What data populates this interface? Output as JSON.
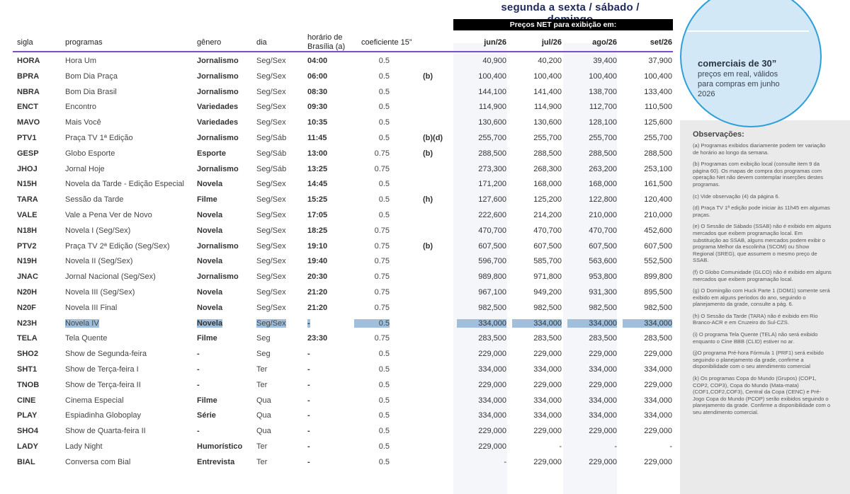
{
  "header": {
    "title": "segunda a sexta / sábado / domingo",
    "price_bar": "Preços NET para exibição em:"
  },
  "columns": {
    "sigla": "sigla",
    "programas": "programas",
    "genero": "gênero",
    "dia": "dia",
    "horario_1": "horário de",
    "horario_2": "Brasília (a)",
    "coeficiente": "coeficiente 15”",
    "months": [
      "jun/26",
      "jul/26",
      "ago/26",
      "set/26"
    ]
  },
  "rows": [
    {
      "sigla": "HORA",
      "programa": "Hora Um",
      "genero": "Jornalismo",
      "dia": "Seg/Sex",
      "horario": "04:00",
      "coef": "0.5",
      "nota": "",
      "jun": "40,900",
      "jul": "40,200",
      "ago": "39,400",
      "set": "37,900"
    },
    {
      "sigla": "BPRA",
      "programa": "Bom Dia Praça",
      "genero": "Jornalismo",
      "dia": "Seg/Sex",
      "horario": "06:00",
      "coef": "0.5",
      "nota": "(b)",
      "jun": "100,400",
      "jul": "100,400",
      "ago": "100,400",
      "set": "100,400"
    },
    {
      "sigla": "NBRA",
      "programa": "Bom Dia Brasil",
      "genero": "Jornalismo",
      "dia": "Seg/Sex",
      "horario": "08:30",
      "coef": "0.5",
      "nota": "",
      "jun": "144,100",
      "jul": "141,400",
      "ago": "138,700",
      "set": "133,400"
    },
    {
      "sigla": "ENCT",
      "programa": "Encontro",
      "genero": "Variedades",
      "dia": "Seg/Sex",
      "horario": "09:30",
      "coef": "0.5",
      "nota": "",
      "jun": "114,900",
      "jul": "114,900",
      "ago": "112,700",
      "set": "110,500"
    },
    {
      "sigla": "MAVO",
      "programa": "Mais Você",
      "genero": "Variedades",
      "dia": "Seg/Sex",
      "horario": "10:35",
      "coef": "0.5",
      "nota": "",
      "jun": "130,600",
      "jul": "130,600",
      "ago": "128,100",
      "set": "125,600"
    },
    {
      "sigla": "PTV1",
      "programa": "Praça TV 1ª Edição",
      "genero": "Jornalismo",
      "dia": "Seg/Sáb",
      "horario": "11:45",
      "coef": "0.5",
      "nota": "(b)(d)",
      "jun": "255,700",
      "jul": "255,700",
      "ago": "255,700",
      "set": "255,700"
    },
    {
      "sigla": "GESP",
      "programa": "Globo Esporte",
      "genero": "Esporte",
      "dia": "Seg/Sáb",
      "horario": "13:00",
      "coef": "0.75",
      "nota": "(b)",
      "jun": "288,500",
      "jul": "288,500",
      "ago": "288,500",
      "set": "288,500"
    },
    {
      "sigla": "JHOJ",
      "programa": "Jornal Hoje",
      "genero": "Jornalismo",
      "dia": "Seg/Sáb",
      "horario": "13:25",
      "coef": "0.75",
      "nota": "",
      "jun": "273,300",
      "jul": "268,300",
      "ago": "263,200",
      "set": "253,100"
    },
    {
      "sigla": "N15H",
      "programa": "Novela da Tarde - Edição Especial",
      "genero": "Novela",
      "dia": "Seg/Sex",
      "horario": "14:45",
      "coef": "0.5",
      "nota": "",
      "jun": "171,200",
      "jul": "168,000",
      "ago": "168,000",
      "set": "161,500"
    },
    {
      "sigla": "TARA",
      "programa": "Sessão da Tarde",
      "genero": "Filme",
      "dia": "Seg/Sex",
      "horario": "15:25",
      "coef": "0.5",
      "nota": "(h)",
      "jun": "127,600",
      "jul": "125,200",
      "ago": "122,800",
      "set": "120,400"
    },
    {
      "sigla": "VALE",
      "programa": "Vale a Pena Ver de Novo",
      "genero": "Novela",
      "dia": "Seg/Sex",
      "horario": "17:05",
      "coef": "0.5",
      "nota": "",
      "jun": "222,600",
      "jul": "214,200",
      "ago": "210,000",
      "set": "210,000"
    },
    {
      "sigla": "N18H",
      "programa": "Novela I (Seg/Sex)",
      "genero": "Novela",
      "dia": "Seg/Sex",
      "horario": "18:25",
      "coef": "0.75",
      "nota": "",
      "jun": "470,700",
      "jul": "470,700",
      "ago": "470,700",
      "set": "452,600"
    },
    {
      "sigla": "PTV2",
      "programa": "Praça TV 2ª Edição (Seg/Sex)",
      "genero": "Jornalismo",
      "dia": "Seg/Sex",
      "horario": "19:10",
      "coef": "0.75",
      "nota": "(b)",
      "jun": "607,500",
      "jul": "607,500",
      "ago": "607,500",
      "set": "607,500"
    },
    {
      "sigla": "N19H",
      "programa": "Novela II (Seg/Sex)",
      "genero": "Novela",
      "dia": "Seg/Sex",
      "horario": "19:40",
      "coef": "0.75",
      "nota": "",
      "jun": "596,700",
      "jul": "585,700",
      "ago": "563,600",
      "set": "552,500"
    },
    {
      "sigla": "JNAC",
      "programa": "Jornal Nacional (Seg/Sex)",
      "genero": "Jornalismo",
      "dia": "Seg/Sex",
      "horario": "20:30",
      "coef": "0.75",
      "nota": "",
      "jun": "989,800",
      "jul": "971,800",
      "ago": "953,800",
      "set": "899,800"
    },
    {
      "sigla": "N20H",
      "programa": "Novela III (Seg/Sex)",
      "genero": "Novela",
      "dia": "Seg/Sex",
      "horario": "21:20",
      "coef": "0.75",
      "nota": "",
      "jun": "967,100",
      "jul": "949,200",
      "ago": "931,300",
      "set": "895,500"
    },
    {
      "sigla": "N20F",
      "programa": "Novela III Final",
      "genero": "Novela",
      "dia": "Seg/Sex",
      "horario": "21:20",
      "coef": "0.75",
      "nota": "",
      "jun": "982,500",
      "jul": "982,500",
      "ago": "982,500",
      "set": "982,500"
    },
    {
      "sigla": "N23H",
      "programa": "Novela IV",
      "genero": "Novela",
      "dia": "Seg/Sex",
      "horario": "-",
      "coef": "0.5",
      "nota": "",
      "jun": "334,000",
      "jul": "334,000",
      "ago": "334,000",
      "set": "334,000",
      "selected": true
    },
    {
      "sigla": "TELA",
      "programa": "Tela Quente",
      "genero": "Filme",
      "dia": "Seg",
      "horario": "23:30",
      "coef": "0.75",
      "nota": "",
      "jun": "283,500",
      "jul": "283,500",
      "ago": "283,500",
      "set": "283,500"
    },
    {
      "sigla": "SHO2",
      "programa": "Show de Segunda-feira",
      "genero": "-",
      "dia": "Seg",
      "horario": "-",
      "coef": "0.5",
      "nota": "",
      "jun": "229,000",
      "jul": "229,000",
      "ago": "229,000",
      "set": "229,000"
    },
    {
      "sigla": "SHT1",
      "programa": "Show de Terça-feira I",
      "genero": "-",
      "dia": "Ter",
      "horario": "-",
      "coef": "0.5",
      "nota": "",
      "jun": "334,000",
      "jul": "334,000",
      "ago": "334,000",
      "set": "334,000"
    },
    {
      "sigla": "TNOB",
      "programa": "Show de Terça-feira II",
      "genero": "-",
      "dia": "Ter",
      "horario": "-",
      "coef": "0.5",
      "nota": "",
      "jun": "229,000",
      "jul": "229,000",
      "ago": "229,000",
      "set": "229,000"
    },
    {
      "sigla": "CINE",
      "programa": "Cinema Especial",
      "genero": "Filme",
      "dia": "Qua",
      "horario": "-",
      "coef": "0.5",
      "nota": "",
      "jun": "334,000",
      "jul": "334,000",
      "ago": "334,000",
      "set": "334,000"
    },
    {
      "sigla": "PLAY",
      "programa": "Espiadinha Globoplay",
      "genero": "Série",
      "dia": "Qua",
      "horario": "-",
      "coef": "0.5",
      "nota": "",
      "jun": "334,000",
      "jul": "334,000",
      "ago": "334,000",
      "set": "334,000"
    },
    {
      "sigla": "SHO4",
      "programa": "Show de Quarta-feira II",
      "genero": "-",
      "dia": "Qua",
      "horario": "-",
      "coef": "0.5",
      "nota": "",
      "jun": "229,000",
      "jul": "229,000",
      "ago": "229,000",
      "set": "229,000"
    },
    {
      "sigla": "LADY",
      "programa": "Lady Night",
      "genero": "Humorístico",
      "dia": "Ter",
      "horario": "-",
      "coef": "0.5",
      "nota": "",
      "jun": "229,000",
      "jul": "-",
      "ago": "-",
      "set": "-"
    },
    {
      "sigla": "BIAL",
      "programa": "Conversa com Bial",
      "genero": "Entrevista",
      "dia": "Ter",
      "horario": "-",
      "coef": "0.5",
      "nota": "",
      "jun": "-",
      "jul": "229,000",
      "ago": "229,000",
      "set": "229,000"
    }
  ],
  "callout": {
    "title": "comerciais de 30”",
    "subtitle": "preços em real, válidos para compras em junho 2026"
  },
  "observations": {
    "title": "Observações:",
    "items": [
      "(a) Programas exibidos diariamente podem ter variação de horário ao longo da semana.",
      "(b) Programas com exibição local (consulte item 9 da página 60). Os mapas de compra dos programas com operação Net não devem contemplar inserções destes programas.",
      "(c) Vide observação (4) da página 6.",
      "(d) Praça TV 1ª edição pode iniciar às 11h45 em algumas praças.",
      "(e) O Sessão de Sábado (SSAB) não é exibido em alguns mercados que exibem programação local. Em substituição ao SSAB, alguns mercados podem exibir o programa Melhor da escolinha (SCOM) ou Show Regional (SREG), que assumem o mesmo preço de SSAB.",
      "(f) O Globo Comunidade (GLCO) não é exibido em alguns mercados que exibem programação local.",
      "(g) O Domingão com Huck  Parte 1 (DOM1) somente será exibido em alguns períodos do ano, seguindo o planejamento da grade, consulte a pág. 6.",
      "(h) O Sessão da Tarde (TARA) não é exibido em Rio Branco-ACR e em Cruzeiro do Sul-CZS.",
      "(i) O programa Tela Quente (TELA) não será exibido enquanto o Cine BBB (CLID) estiver no ar.",
      "(j)O programa Pré-hora Fórmula 1 (PRF1) será exibido seguindo o planejamento da grade, confirme a disponibilidade com o seu atendimento comercial",
      " (k) Os programas Copa do Mundo (Grupos) (COP1, COP2, COP3), Copa do Mundo (Mata-mata) (COF1,COF2,COF3), Central da Copa (CENC) e Pré-Jogo Copa do Mundo (PCOP) serão exibidos seguindo o planejamento da grade. Confirme a disponibilidade com o seu atendimento comercial."
    ]
  },
  "colors": {
    "accent_purple": "#7a4fc7",
    "callout_blue": "#2e9fd8",
    "selection": "#9fbfdc"
  }
}
